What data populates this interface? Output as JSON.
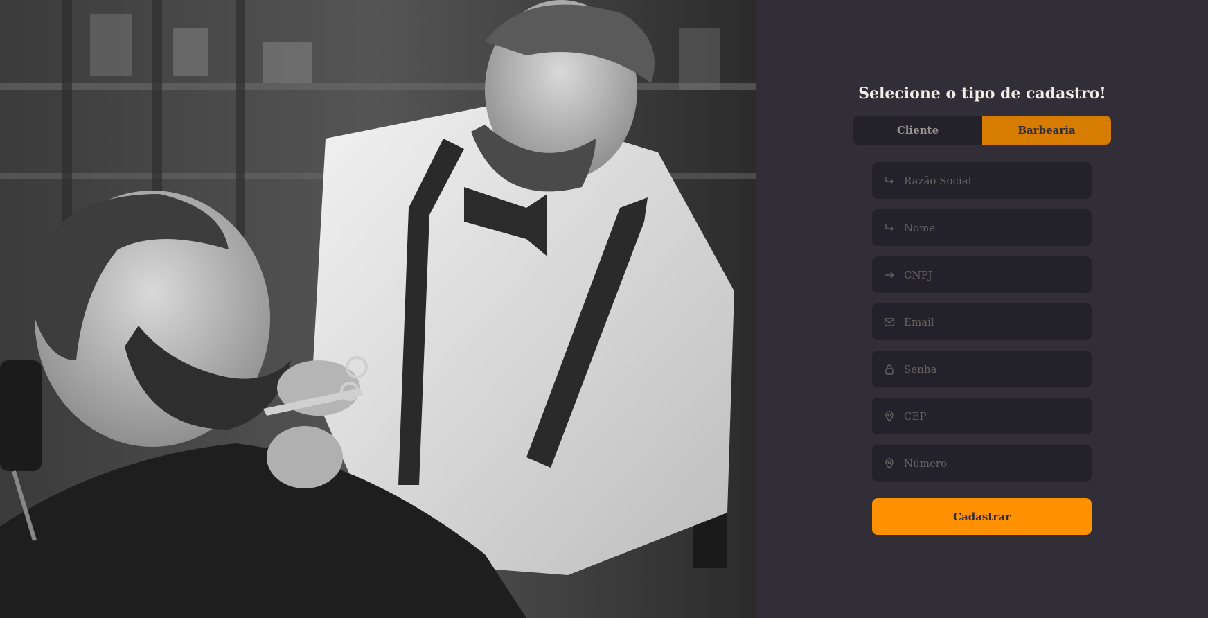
{
  "photo": {
    "alt": "Barbeiro aparando a barba de um cliente"
  },
  "form": {
    "title": "Selecione o tipo de cadastro!",
    "tabs": [
      {
        "label": "Cliente",
        "active": false
      },
      {
        "label": "Barbearia",
        "active": true
      }
    ],
    "fields": [
      {
        "placeholder": "Razão Social",
        "icon": "corner-down-right-icon",
        "value": ""
      },
      {
        "placeholder": "Nome",
        "icon": "corner-down-right-icon",
        "value": ""
      },
      {
        "placeholder": "CNPJ",
        "icon": "arrow-right-icon",
        "value": ""
      },
      {
        "placeholder": "Email",
        "icon": "mail-icon",
        "value": ""
      },
      {
        "placeholder": "Senha",
        "icon": "lock-icon",
        "value": ""
      },
      {
        "placeholder": "CEP",
        "icon": "map-pin-icon",
        "value": ""
      },
      {
        "placeholder": "Número",
        "icon": "map-pin-icon",
        "value": ""
      }
    ],
    "submit_label": "Cadastrar"
  },
  "colors": {
    "background": "#312e38",
    "input_bg": "#232129",
    "accent": "#ff9000",
    "tab_active": "#d67c00",
    "text": "#f4ede8",
    "placeholder": "#666360"
  }
}
